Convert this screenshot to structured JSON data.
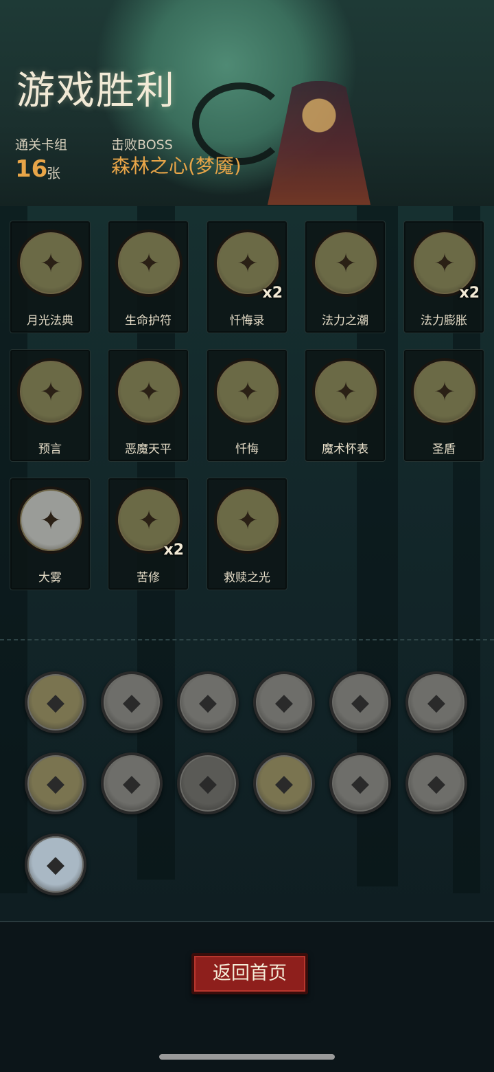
{
  "header": {
    "title": "游戏胜利",
    "deck_label": "通关卡组",
    "deck_count": "16",
    "deck_unit": "张",
    "boss_label": "击败BOSS",
    "boss_name": "森林之心(梦魇)"
  },
  "cards": [
    {
      "name": "月光法典",
      "count": "",
      "icon": "moonlight-codex-icon",
      "color": "#6b6a46"
    },
    {
      "name": "生命护符",
      "count": "",
      "icon": "bat-amulet-icon",
      "color": "#6b6a46"
    },
    {
      "name": "忏悔录",
      "count": "x2",
      "icon": "confession-book-icon",
      "color": "#6b6a46"
    },
    {
      "name": "法力之潮",
      "count": "",
      "icon": "mana-wave-icon",
      "color": "#6b6a46"
    },
    {
      "name": "法力膨胀",
      "count": "x2",
      "icon": "mana-surge-icon",
      "color": "#6b6a46"
    },
    {
      "name": "预言",
      "count": "",
      "icon": "prophet-icon",
      "color": "#6b6a46"
    },
    {
      "name": "恶魔天平",
      "count": "",
      "icon": "demon-scale-icon",
      "color": "#6b6a46"
    },
    {
      "name": "忏悔",
      "count": "",
      "icon": "cross-icon",
      "color": "#6b6a46"
    },
    {
      "name": "魔术怀表",
      "count": "",
      "icon": "pocket-watch-icon",
      "color": "#6b6a46"
    },
    {
      "name": "圣盾",
      "count": "",
      "icon": "holy-shield-icon",
      "color": "#6b6a46"
    },
    {
      "name": "大雾",
      "count": "",
      "icon": "fog-icon",
      "color": "#9a9c98"
    },
    {
      "name": "苦修",
      "count": "x2",
      "icon": "penance-icon",
      "color": "#6b6a46"
    },
    {
      "name": "救赎之光",
      "count": "",
      "icon": "redemption-light-icon",
      "color": "#6b6a46"
    }
  ],
  "relics": [
    {
      "icon": "lightning-altar-icon",
      "color": "#7a7450"
    },
    {
      "icon": "red-music-skull-icon",
      "color": "#6e6e6a"
    },
    {
      "icon": "yellow-music-skull-icon",
      "color": "#6e6e6a"
    },
    {
      "icon": "blue-music-skull-icon",
      "color": "#6e6e6a"
    },
    {
      "icon": "green-music-skull-icon",
      "color": "#6e6e6a"
    },
    {
      "icon": "purple-music-skull-icon",
      "color": "#6e6e6a"
    },
    {
      "icon": "horned-skull-icon",
      "color": "#7a7450"
    },
    {
      "icon": "sword-coins-icon",
      "color": "#6e6e6a"
    },
    {
      "icon": "red-tome-icon",
      "color": "#5a5a56"
    },
    {
      "icon": "hand-cards-icon",
      "color": "#7a7450"
    },
    {
      "icon": "red-demon-icon",
      "color": "#6e6e6a"
    },
    {
      "icon": "sword-coins-icon",
      "color": "#6e6e6a"
    },
    {
      "icon": "dagger-icon",
      "color": "#a9b8c4"
    }
  ],
  "footer": {
    "home_label": "返回首页"
  },
  "colors": {
    "accent_gold": "#e8a548",
    "button_red": "#8e1f1c"
  }
}
